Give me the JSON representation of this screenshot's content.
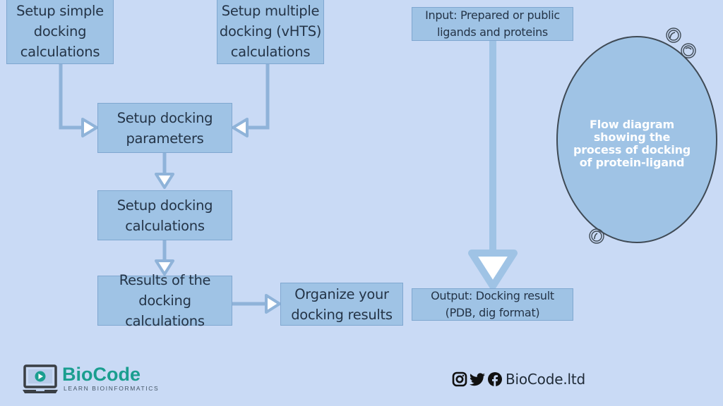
{
  "diagram": {
    "title": "Flow diagram showing the process of docking of protein-ligand",
    "nodes": {
      "simple": [
        "Setup simple",
        "docking",
        "calculations"
      ],
      "multiple": [
        "Setup multiple",
        "docking (vHTS)",
        "calculations"
      ],
      "parameters": [
        "Setup docking",
        "parameters"
      ],
      "calculations": [
        "Setup docking",
        "calculations"
      ],
      "results": [
        "Results of the",
        "docking calculations"
      ],
      "organize": [
        "Organize your",
        "docking results"
      ],
      "input": [
        "Input: Prepared or public",
        "ligands and proteins"
      ],
      "output": [
        "Output: Docking result",
        "(PDB, dig format)"
      ]
    },
    "edges": [
      {
        "from": "simple",
        "to": "parameters"
      },
      {
        "from": "multiple",
        "to": "parameters"
      },
      {
        "from": "parameters",
        "to": "calculations"
      },
      {
        "from": "calculations",
        "to": "results"
      },
      {
        "from": "results",
        "to": "organize"
      },
      {
        "from": "input",
        "to": "output"
      }
    ],
    "oval_label": [
      "Flow diagram",
      "showing the",
      "process of docking",
      "of protein-ligand"
    ]
  },
  "branding": {
    "logo_name": "BioCode",
    "logo_tagline": "LEARN BIOINFORMATICS",
    "social_icons": [
      "instagram-icon",
      "twitter-icon",
      "facebook-icon"
    ],
    "handle": "BioCode.ltd",
    "brand_color": "#1a9e8f"
  },
  "colors": {
    "background": "#c9daf5",
    "box_fill": "#9fc3e5",
    "box_border": "#7fa7d0",
    "text": "#243447"
  }
}
